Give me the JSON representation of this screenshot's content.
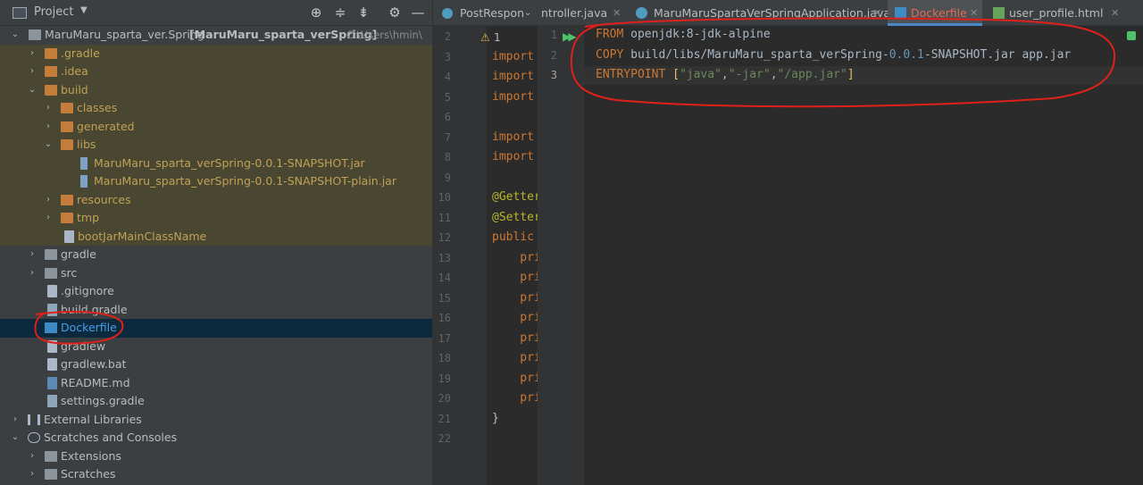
{
  "project_panel": {
    "title": "Project",
    "tree": [
      {
        "label": "MaruMaru_sparta_ver.Spring",
        "extra": "[MaruMaru_sparta_verSpring]",
        "path": "C:\\Users\\hmin\\"
      },
      {
        "label": ".gradle"
      },
      {
        "label": ".idea"
      },
      {
        "label": "build"
      },
      {
        "label": "classes"
      },
      {
        "label": "generated"
      },
      {
        "label": "libs"
      },
      {
        "label": "MaruMaru_sparta_verSpring-0.0.1-SNAPSHOT.jar"
      },
      {
        "label": "MaruMaru_sparta_verSpring-0.0.1-SNAPSHOT-plain.jar"
      },
      {
        "label": "resources"
      },
      {
        "label": "tmp"
      },
      {
        "label": "bootJarMainClassName"
      },
      {
        "label": "gradle"
      },
      {
        "label": "src"
      },
      {
        "label": ".gitignore"
      },
      {
        "label": "build.gradle"
      },
      {
        "label": "Dockerfile"
      },
      {
        "label": "gradlew"
      },
      {
        "label": "gradlew.bat"
      },
      {
        "label": "README.md"
      },
      {
        "label": "settings.gradle"
      },
      {
        "label": "External Libraries"
      },
      {
        "label": "Scratches and Consoles"
      },
      {
        "label": "Extensions"
      },
      {
        "label": "Scratches"
      }
    ]
  },
  "tabs": {
    "post_response": "PostRespon",
    "controller": "ntroller.java",
    "application": "MaruMaruSpartaVerSpringApplication.java",
    "dockerfile": "Dockerfile",
    "user_profile": "user_profile.html"
  },
  "mid_editor": {
    "warning_count": "1",
    "lines": [
      {
        "n": "2",
        "t": ""
      },
      {
        "n": "3",
        "t": "import"
      },
      {
        "n": "4",
        "t": "import"
      },
      {
        "n": "5",
        "t": "import"
      },
      {
        "n": "6",
        "t": ""
      },
      {
        "n": "7",
        "t": "import"
      },
      {
        "n": "8",
        "t": "import"
      },
      {
        "n": "9",
        "t": ""
      },
      {
        "n": "10",
        "t": "@Getter"
      },
      {
        "n": "11",
        "t": "@Setter"
      },
      {
        "n": "12",
        "t": "public"
      },
      {
        "n": "13",
        "t": "    pri"
      },
      {
        "n": "14",
        "t": "    pri"
      },
      {
        "n": "15",
        "t": "    pri"
      },
      {
        "n": "16",
        "t": "    pri"
      },
      {
        "n": "17",
        "t": "    pri"
      },
      {
        "n": "18",
        "t": "    pri"
      },
      {
        "n": "19",
        "t": "    pri"
      },
      {
        "n": "20",
        "t": "    pri"
      },
      {
        "n": "21",
        "t": "}"
      },
      {
        "n": "22",
        "t": ""
      }
    ]
  },
  "dockerfile": {
    "line_numbers": [
      "1",
      "2",
      "3"
    ],
    "from_kw": "FROM",
    "from_val": " openjdk:8-jdk-alpine",
    "copy_kw": "COPY",
    "copy_val_a": " build/libs/MaruMaru_sparta_verSpring-",
    "copy_num": "0.0.1",
    "copy_val_b": "-SNAPSHOT.jar app.jar",
    "entry_kw": "ENTRYPOINT",
    "entry_sp": " ",
    "entry_open": "[",
    "entry_s1": "\"java\"",
    "entry_c1": ",",
    "entry_s2": "\"-jar\"",
    "entry_c2": ",",
    "entry_s3": "\"/app.jar\"",
    "entry_close": "]"
  },
  "colors": {
    "highlight_yellow": "#c1a255",
    "annotation_red": "#e0201a",
    "selection": "#0d293e"
  }
}
